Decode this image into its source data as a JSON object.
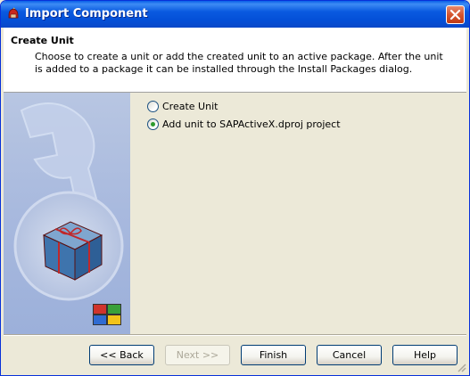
{
  "window": {
    "title": "Import Component",
    "app_icon": "delphi-helmet-icon"
  },
  "header": {
    "title": "Create Unit",
    "description": "Choose to create a unit or add the created unit to an active package. After the unit is added to a package it can be installed through the Install Packages dialog."
  },
  "options": [
    {
      "label": "Create Unit",
      "checked": false
    },
    {
      "label": "Add unit to SAPActiveX.dproj project",
      "checked": true
    }
  ],
  "buttons": {
    "back": "<< Back",
    "next": "Next >>",
    "finish": "Finish",
    "cancel": "Cancel",
    "help": "Help"
  },
  "colors": {
    "title_bar": "#0a5ae0",
    "close_button": "#d5552f",
    "banner": "#a8b9de"
  }
}
